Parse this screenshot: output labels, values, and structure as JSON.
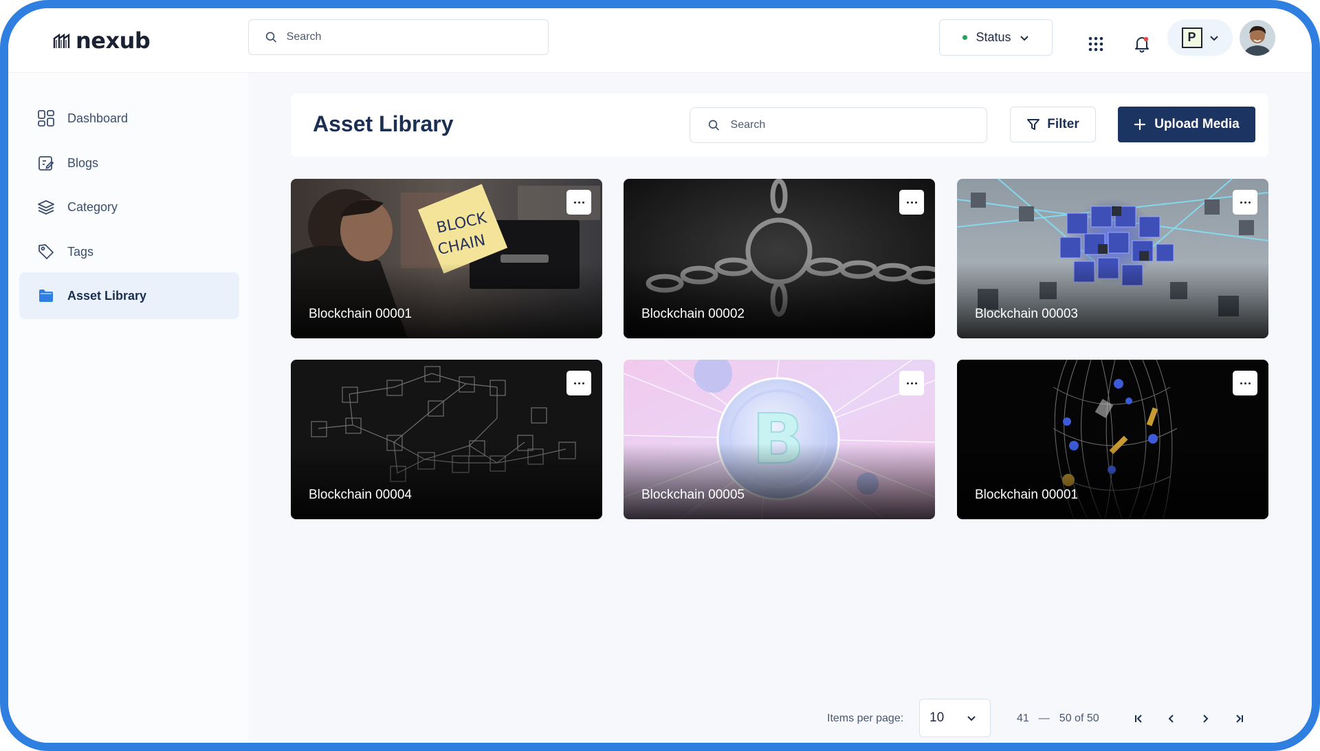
{
  "app": {
    "logo_text": "nexub",
    "search_placeholder": "Search",
    "status_label": "Status",
    "status_color": "#22a55b",
    "workspace_badge": "P",
    "accent": "#2f7fe0",
    "primary": "#1b3462"
  },
  "sidebar": {
    "items": [
      {
        "label": "Dashboard",
        "icon": "dashboard-grid-icon"
      },
      {
        "label": "Blogs",
        "icon": "edit-note-icon"
      },
      {
        "label": "Category",
        "icon": "layers-icon"
      },
      {
        "label": "Tags",
        "icon": "tag-icon"
      },
      {
        "label": "Asset Library",
        "icon": "folder-icon",
        "active": true
      }
    ]
  },
  "main": {
    "title": "Asset Library",
    "search_placeholder": "Search",
    "filter_label": "Filter",
    "upload_label": "Upload Media",
    "assets": [
      {
        "caption": "Blockchain 00001",
        "theme": "sticky-note-photo"
      },
      {
        "caption": "Blockchain 00002",
        "theme": "chain-links"
      },
      {
        "caption": "Blockchain 00003",
        "theme": "blue-cubes"
      },
      {
        "caption": "Blockchain 00004",
        "theme": "wireframe-cubes"
      },
      {
        "caption": "Blockchain 00005",
        "theme": "bitcoin-pink"
      },
      {
        "caption": "Blockchain 00001",
        "theme": "dark-crypto-swirl"
      }
    ]
  },
  "pagination": {
    "items_per_page_label": "Items per page:",
    "items_per_page_value": "10",
    "range_start": "41",
    "range_dash": "—",
    "range_end": "50 of 50"
  }
}
